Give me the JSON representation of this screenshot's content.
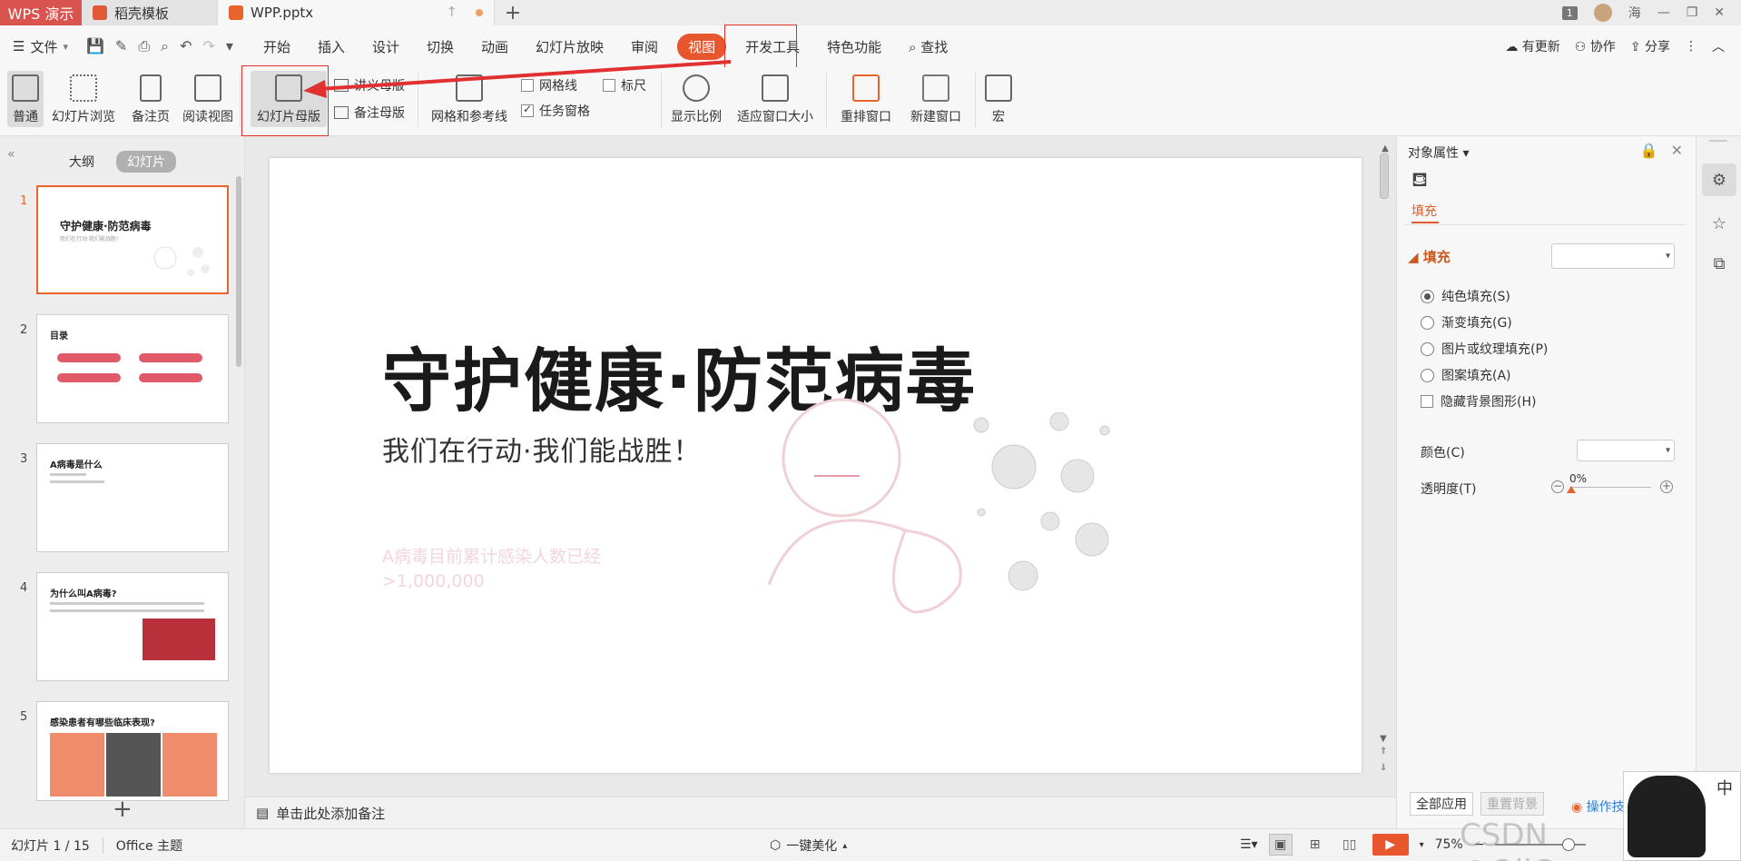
{
  "titlebar": {
    "app_tab": "WPS 演示",
    "tabs": [
      {
        "label": "稻壳模板"
      },
      {
        "label": "WPP.pptx"
      }
    ],
    "badge": "1",
    "user": "海"
  },
  "menubar": {
    "file": "文件",
    "items": [
      "开始",
      "插入",
      "设计",
      "切换",
      "动画",
      "幻灯片放映",
      "审阅",
      "视图",
      "开发工具",
      "特色功能"
    ],
    "active": "视图",
    "search": "查找",
    "right": [
      "有更新",
      "协作",
      "分享"
    ]
  },
  "ribbon": {
    "normal": "普通",
    "slide_browse": "幻灯片浏览",
    "notes_page": "备注页",
    "reading_view": "阅读视图",
    "slide_master": "幻灯片母版",
    "handout_master": "讲义母版",
    "notes_master": "备注母版",
    "grid_guides": "网格和参考线",
    "gridlines": "网格线",
    "ruler": "标尺",
    "task_pane": "任务窗格",
    "zoom": "显示比例",
    "fit_window": "适应窗口大小",
    "arrange": "重排窗口",
    "new_window": "新建窗口",
    "macro": "宏"
  },
  "leftpanel": {
    "tab_outline": "大纲",
    "tab_slides": "幻灯片",
    "slides": [
      {
        "num": "1",
        "title": "守护健康·防范病毒",
        "sub": "我们在行动·我们能战胜!"
      },
      {
        "num": "2",
        "title": "目录",
        "sub": ""
      },
      {
        "num": "3",
        "title": "A病毒是什么",
        "sub": ""
      },
      {
        "num": "4",
        "title": "为什么叫A病毒?",
        "sub": ""
      },
      {
        "num": "5",
        "title": "感染患者有哪些临床表现?",
        "sub": ""
      }
    ]
  },
  "slide": {
    "title": "守护健康·防范病毒",
    "subtitle": "我们在行动·我们能战胜！",
    "faint_line1": "A病毒目前累计感染人数已经",
    "faint_line2": ">1,000,000"
  },
  "notes": {
    "placeholder": "单击此处添加备注"
  },
  "rightpanel": {
    "title": "对象属性",
    "fill_tab": "填充",
    "section": "填充",
    "options": [
      "纯色填充(S)",
      "渐变填充(G)",
      "图片或纹理填充(P)",
      "图案填充(A)"
    ],
    "hide_bg": "隐藏背景图形(H)",
    "color_label": "颜色(C)",
    "transparency_label": "透明度(T)",
    "transparency_value": "0%",
    "apply_all": "全部应用",
    "reset_bg": "重置背景",
    "tips": "操作技"
  },
  "statusbar": {
    "slide_info": "幻灯片 1 / 15",
    "theme": "Office 主题",
    "beautify": "一键美化",
    "zoom": "75%"
  },
  "watermark": "CSDN @OliCorrect",
  "colors": {
    "accent": "#e8562e",
    "app_red": "#d9534f",
    "highlight": "#e03030"
  }
}
